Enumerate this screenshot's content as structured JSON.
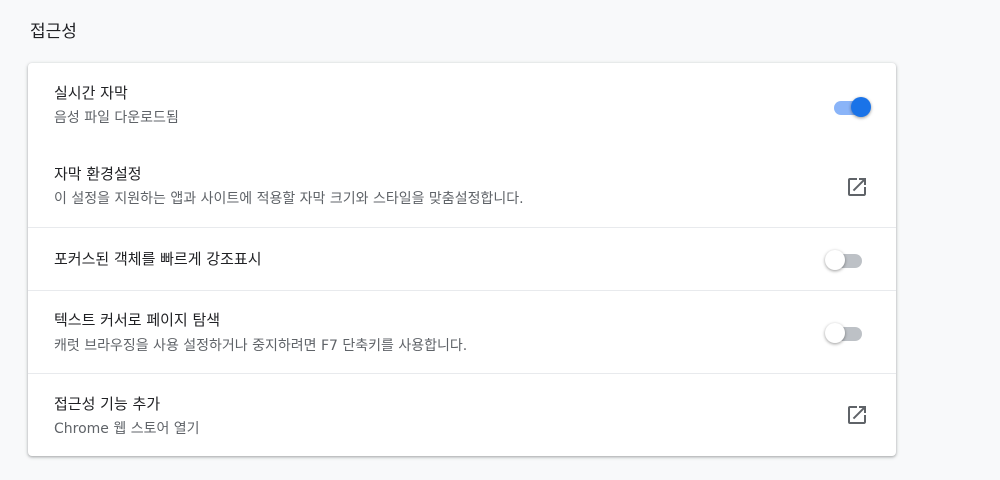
{
  "section": {
    "title": "접근성"
  },
  "items": [
    {
      "title": "실시간 자막",
      "subtitle": "음성 파일 다운로드됨",
      "control": "toggle",
      "state": "on"
    },
    {
      "title": "자막 환경설정",
      "subtitle": "이 설정을 지원하는 앱과 사이트에 적용할 자막 크기와 스타일을 맞춤설정합니다.",
      "control": "external-link-icon"
    },
    {
      "title": "포커스된 객체를 빠르게 강조표시",
      "control": "toggle",
      "state": "off"
    },
    {
      "title": "텍스트 커서로 페이지 탐색",
      "subtitle": "캐럿 브라우징을 사용 설정하거나 중지하려면 F7 단축키를 사용합니다.",
      "control": "toggle",
      "state": "off"
    },
    {
      "title": "접근성 기능 추가",
      "subtitle": "Chrome 웹 스토어 열기",
      "control": "external-link-icon"
    }
  ],
  "colors": {
    "toggle_on_knob": "#1a73e8",
    "toggle_on_track": "#8ab4f8",
    "toggle_off_track": "#bdc1c6"
  }
}
